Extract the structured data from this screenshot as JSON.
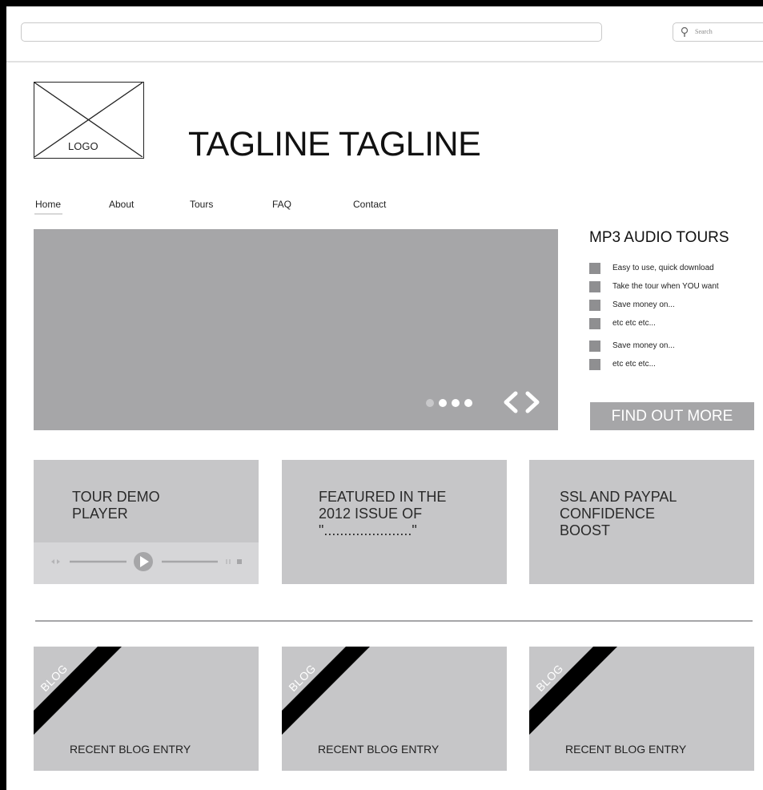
{
  "browser": {
    "search_placeholder": "Search"
  },
  "header": {
    "logo_text": "LOGO",
    "tagline": "TAGLINE TAGLINE"
  },
  "nav": {
    "items": [
      {
        "label": "Home",
        "active": true
      },
      {
        "label": "About"
      },
      {
        "label": "Tours"
      },
      {
        "label": "FAQ"
      },
      {
        "label": "Contact"
      }
    ]
  },
  "hero": {
    "slide_count": 4,
    "active_slide": 2
  },
  "sidebar": {
    "title": "MP3 AUDIO TOURS",
    "features": [
      "Easy to use, quick download",
      "Take the tour when YOU want",
      "Save money on...",
      "etc etc etc...",
      "Save money on...",
      "etc etc etc..."
    ],
    "cta_label": "FIND OUT MORE"
  },
  "cards": [
    {
      "title": "TOUR DEMO\nPLAYER"
    },
    {
      "title": "FEATURED IN THE\n2012 ISSUE OF\n\"......................\""
    },
    {
      "title": "SSL AND PAYPAL\nCONFIDENCE\nBOOST"
    }
  ],
  "blog": {
    "ribbon_label": "BLOG",
    "entries": [
      "RECENT BLOG ENTRY",
      "RECENT BLOG ENTRY",
      "RECENT BLOG ENTRY"
    ]
  },
  "colors": {
    "placeholder_gray": "#a6a6a8",
    "card_gray": "#c6c6c8",
    "ribbon": "#000000"
  }
}
